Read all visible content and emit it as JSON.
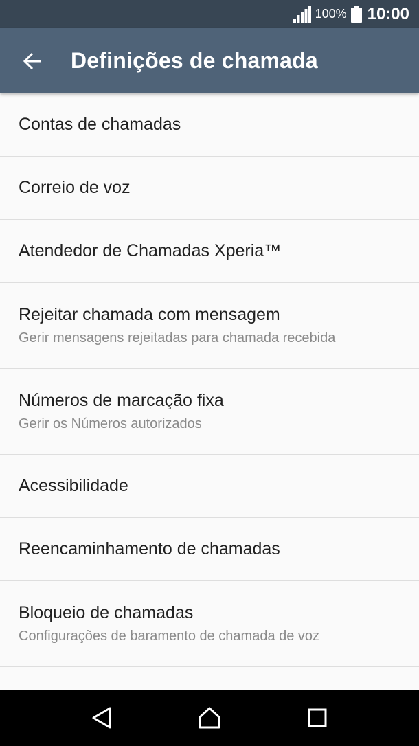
{
  "status_bar": {
    "battery_percent": "100%",
    "time": "10:00",
    "icons": [
      "signal-icon",
      "battery-icon"
    ]
  },
  "app_bar": {
    "back_icon": "arrow-left-icon",
    "title": "Definições de chamada"
  },
  "settings": {
    "items": [
      {
        "title": "Contas de chamadas"
      },
      {
        "title": "Correio de voz"
      },
      {
        "title": "Atendedor de Chamadas Xperia™"
      },
      {
        "title": "Rejeitar chamada com mensagem",
        "summary": "Gerir mensagens rejeitadas para chamada recebida"
      },
      {
        "title": "Números de marcação fixa",
        "summary": "Gerir os Números autorizados"
      },
      {
        "title": "Acessibilidade"
      },
      {
        "title": "Reencaminhamento de chamadas"
      },
      {
        "title": "Bloqueio de chamadas",
        "summary": "Configurações de baramento de chamada de voz"
      }
    ]
  },
  "nav_bar": {
    "icons": [
      "back-triangle-icon",
      "home-icon",
      "recents-square-icon"
    ]
  },
  "colors": {
    "status_bar": "#384654",
    "app_bar": "#4f6378",
    "background": "#fafafa",
    "divider": "#dedede",
    "title_text": "#212121",
    "summary_text": "#8a8a8a"
  }
}
